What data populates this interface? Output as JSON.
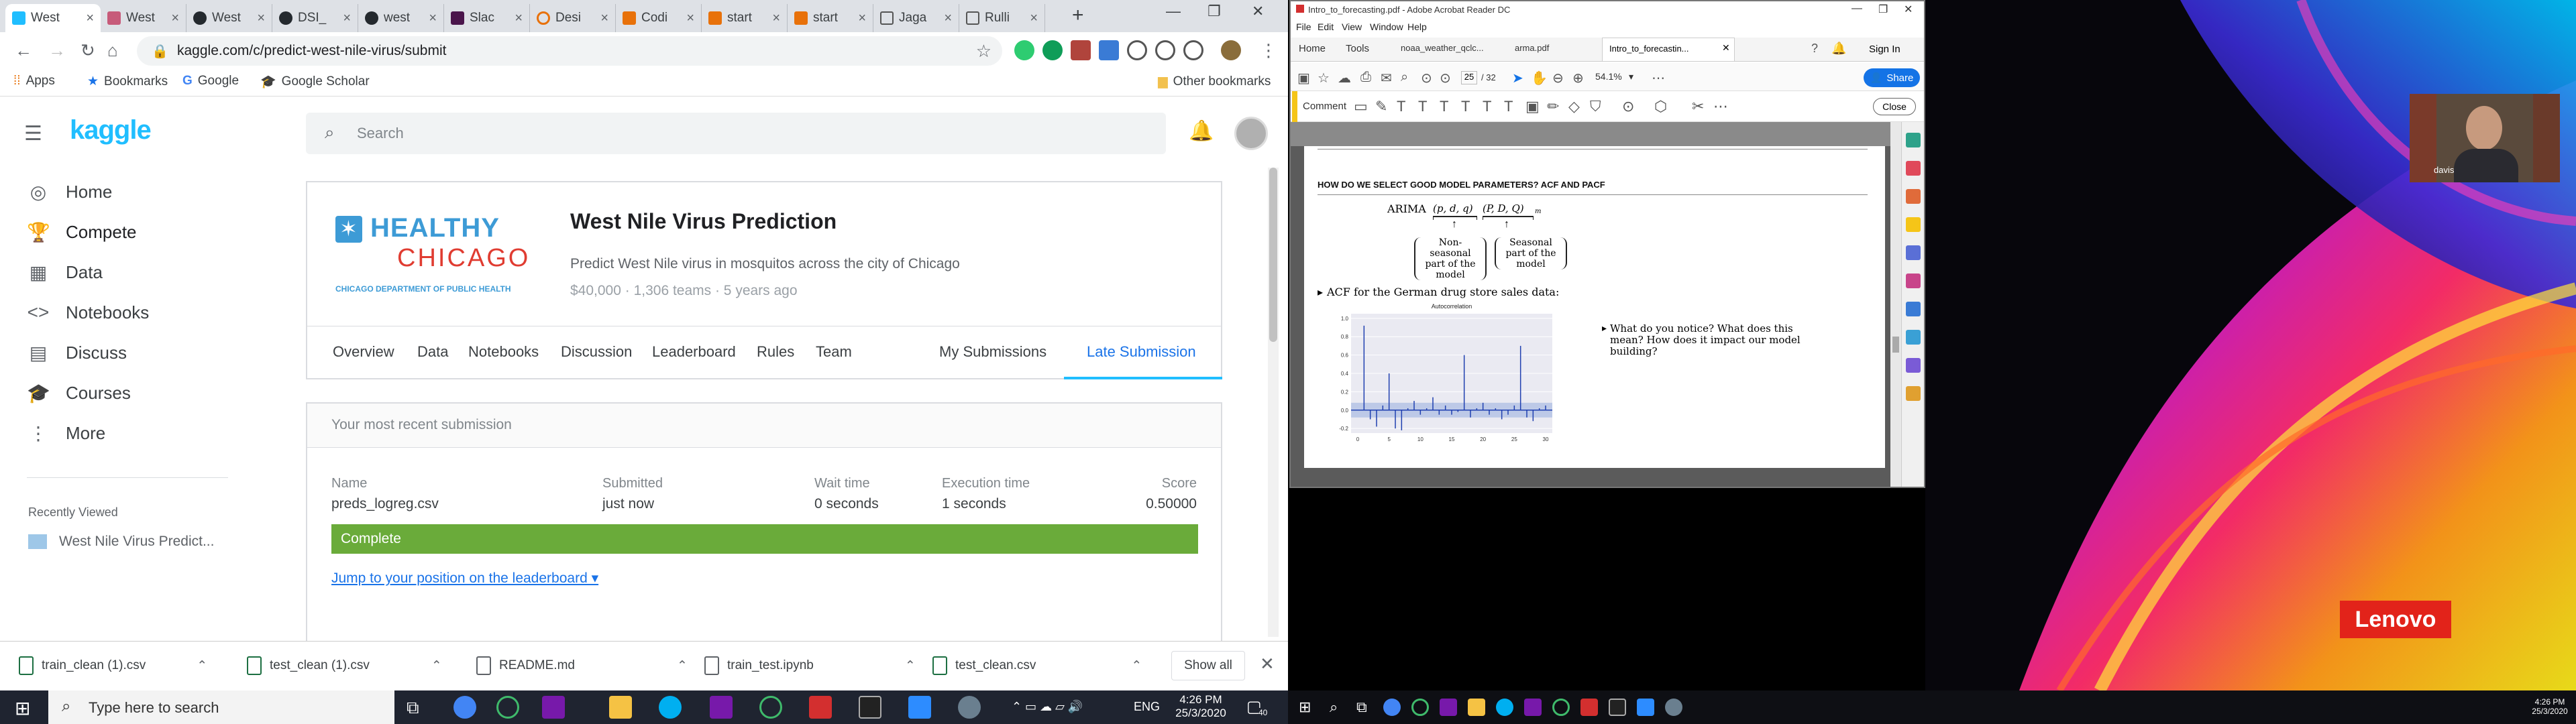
{
  "browser": {
    "tabs": [
      "West",
      "West",
      "West",
      "DSI_",
      "west",
      "Slac",
      "Desi",
      "Codi",
      "start",
      "start",
      "Jaga",
      "Rulli"
    ],
    "url": "kaggle.com/c/predict-west-nile-virus/submit",
    "bookmarks": {
      "apps": "Apps",
      "bookmarks": "Bookmarks",
      "google": "Google",
      "scholar": "Google Scholar",
      "other": "Other bookmarks"
    }
  },
  "kaggle": {
    "logo": "kaggle",
    "search_placeholder": "Search",
    "nav": [
      {
        "label": "Home",
        "icon": "compass-icon"
      },
      {
        "label": "Compete",
        "icon": "trophy-icon"
      },
      {
        "label": "Data",
        "icon": "table-icon"
      },
      {
        "label": "Notebooks",
        "icon": "code-icon"
      },
      {
        "label": "Discuss",
        "icon": "list-icon"
      },
      {
        "label": "Courses",
        "icon": "graduation-cap-icon"
      },
      {
        "label": "More",
        "icon": "more-vert-icon"
      }
    ],
    "recently_viewed": "Recently Viewed",
    "recent_item": "West Nile Virus Predict...",
    "competition": {
      "logo_top": "HEALTHY",
      "logo_mid": "CHICAGO",
      "logo_bottom": "CHICAGO DEPARTMENT OF PUBLIC HEALTH",
      "title": "West Nile Virus Prediction",
      "subtitle": "Predict West Nile virus in mosquitos across the city of Chicago",
      "meta": "$40,000 · 1,306 teams · 5 years ago"
    },
    "tabs": [
      "Overview",
      "Data",
      "Notebooks",
      "Discussion",
      "Leaderboard",
      "Rules",
      "Team"
    ],
    "my_submissions": "My Submissions",
    "late_submission": "Late Submission",
    "recent_header": "Your most recent submission",
    "table": {
      "headers": [
        "Name",
        "Submitted",
        "Wait time",
        "Execution time",
        "Score"
      ],
      "row": [
        "preds_logreg.csv",
        "just now",
        "0 seconds",
        "1 seconds",
        "0.50000"
      ]
    },
    "status": "Complete",
    "jump": "Jump to your position on the leaderboard ▾"
  },
  "downloads": {
    "items": [
      "train_clean (1).csv",
      "test_clean (1).csv",
      "README.md",
      "train_test.ipynb",
      "test_clean.csv"
    ],
    "show_all": "Show all"
  },
  "taskbar_left": {
    "search": "Type here to search",
    "lang": "ENG",
    "time": "4:26 PM",
    "date": "25/3/2020",
    "badge": "40"
  },
  "acrobat": {
    "title": "Intro_to_forecasting.pdf - Adobe Acrobat Reader DC",
    "menu": [
      "File",
      "Edit",
      "View",
      "Window",
      "Help"
    ],
    "tabs": [
      "Home",
      "Tools",
      "noaa_weather_qclc...",
      "arma.pdf",
      "Intro_to_forecastin..."
    ],
    "sign_in": "Sign In",
    "page": "25",
    "pages": "/ 32",
    "zoom": "54.1%",
    "share": "Share",
    "comment": "Comment",
    "close": "Close",
    "doc": {
      "heading": "HOW DO WE SELECT GOOD MODEL PARAMETERS? ACF AND PACF",
      "arima": "ARIMA",
      "pdq": "(p, d, q)",
      "PDQ": "(P, D, Q)",
      "m": "m",
      "nonseasonal": "Non-seasonal part of the model",
      "seasonal": "Seasonal part of the model",
      "acf_line": "ACF for the German drug store sales data:",
      "chart_title": "Autocorrelation",
      "question": "What do you notice? What does this mean? How does it impact our model building?"
    }
  },
  "webcam": {
    "name": "davis"
  },
  "brand": "Lenovo",
  "taskbar_right": {
    "time": "4:26 PM",
    "date": "25/3/2020"
  },
  "chart_data": {
    "type": "bar",
    "title": "Autocorrelation",
    "xlabel": "",
    "ylabel": "",
    "x": [
      1,
      2,
      3,
      4,
      5,
      6,
      7,
      8,
      9,
      10,
      11,
      12,
      13,
      14,
      15,
      16,
      17,
      18,
      19,
      20,
      21,
      22,
      23,
      24,
      25,
      26,
      27,
      28,
      29,
      30
    ],
    "values": [
      0.92,
      -0.1,
      -0.18,
      0.05,
      0.4,
      -0.2,
      -0.22,
      0.02,
      0.1,
      -0.05,
      0.02,
      0.14,
      -0.05,
      0.05,
      -0.05,
      -0.02,
      0.6,
      -0.08,
      0.02,
      0.08,
      -0.05,
      0.02,
      -0.1,
      -0.05,
      0.05,
      0.7,
      -0.08,
      -0.12,
      0.02,
      0.05
    ],
    "xticks": [
      "0",
      "5",
      "10",
      "15",
      "20",
      "25",
      "30"
    ],
    "yticks": [
      "1.0",
      "0.8",
      "0.6",
      "0.4",
      "0.2",
      "0.0",
      "-0.2"
    ],
    "ylim": [
      -0.25,
      1.05
    ],
    "confidence_band": 0.08
  }
}
